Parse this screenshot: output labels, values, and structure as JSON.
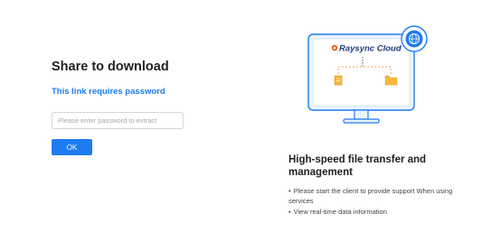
{
  "share": {
    "title": "Share to download",
    "subtitle": "This link requires password",
    "password_placeholder": "Please enter password to extract",
    "ok_label": "OK"
  },
  "promo": {
    "logo_text": "Raysync Cloud",
    "title": "High-speed file transfer and management",
    "features": [
      "Please start the client to provide support When using services",
      "View real-time data information"
    ],
    "bullet": "•"
  },
  "colors": {
    "accent": "#1e7cf0",
    "folder": "#f7b93a",
    "monitor_bg": "#e9f3ff",
    "logo_orange": "#f0601c"
  },
  "icons": [
    "globe-icon",
    "folder-icon",
    "document-icon",
    "raysync-logo-icon"
  ]
}
